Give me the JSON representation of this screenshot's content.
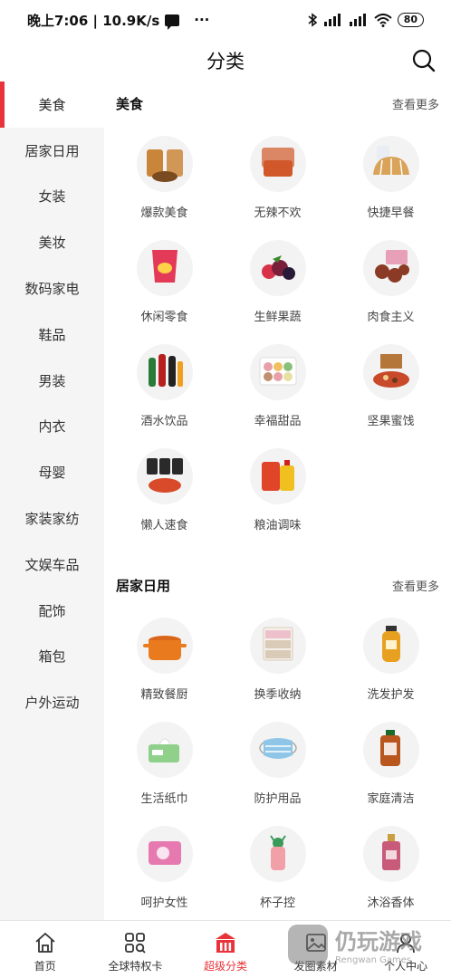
{
  "status_bar": {
    "time_speed": "晚上7:06 | 10.9K/s",
    "more": "···",
    "battery": "80"
  },
  "header": {
    "title": "分类"
  },
  "sidebar": {
    "items": [
      {
        "label": "美食"
      },
      {
        "label": "居家日用"
      },
      {
        "label": "女装"
      },
      {
        "label": "美妆"
      },
      {
        "label": "数码家电"
      },
      {
        "label": "鞋品"
      },
      {
        "label": "男装"
      },
      {
        "label": "内衣"
      },
      {
        "label": "母婴"
      },
      {
        "label": "家装家纺"
      },
      {
        "label": "文娱车品"
      },
      {
        "label": "配饰"
      },
      {
        "label": "箱包"
      },
      {
        "label": "户外运动"
      }
    ]
  },
  "sections": [
    {
      "title": "美食",
      "more": "查看更多",
      "items": [
        {
          "label": "爆款美食",
          "icon": "snack-bag-icon",
          "color": "#c9863a"
        },
        {
          "label": "无辣不欢",
          "icon": "spicy-meat-icon",
          "color": "#d0582a"
        },
        {
          "label": "快捷早餐",
          "icon": "bread-icon",
          "color": "#d9a35a"
        },
        {
          "label": "休闲零食",
          "icon": "chips-bag-icon",
          "color": "#e23a57"
        },
        {
          "label": "生鲜果蔬",
          "icon": "berries-icon",
          "color": "#7a1f3a"
        },
        {
          "label": "肉食主义",
          "icon": "braised-meat-icon",
          "color": "#8a3a25"
        },
        {
          "label": "酒水饮品",
          "icon": "bottles-icon",
          "color": "#b82020"
        },
        {
          "label": "幸福甜品",
          "icon": "macaron-icon",
          "color": "#e8a0a8"
        },
        {
          "label": "坚果蜜饯",
          "icon": "nuts-box-icon",
          "color": "#b5763a"
        },
        {
          "label": "懒人速食",
          "icon": "noodles-icon",
          "color": "#2a2a2a"
        },
        {
          "label": "粮油调味",
          "icon": "rice-oil-icon",
          "color": "#e0452a"
        }
      ]
    },
    {
      "title": "居家日用",
      "more": "查看更多",
      "items": [
        {
          "label": "精致餐厨",
          "icon": "pot-icon",
          "color": "#ea7a1e"
        },
        {
          "label": "换季收纳",
          "icon": "storage-drawer-icon",
          "color": "#d9cbb8"
        },
        {
          "label": "洗发护发",
          "icon": "shampoo-icon",
          "color": "#e8a020"
        },
        {
          "label": "生活纸巾",
          "icon": "tissue-icon",
          "color": "#8fd08a"
        },
        {
          "label": "防护用品",
          "icon": "mask-icon",
          "color": "#8fc6e8"
        },
        {
          "label": "家庭清洁",
          "icon": "disinfectant-icon",
          "color": "#b8561e"
        },
        {
          "label": "呵护女性",
          "icon": "pad-pack-icon",
          "color": "#e67ab0"
        },
        {
          "label": "杯子控",
          "icon": "cup-icon",
          "color": "#f2a0a8"
        },
        {
          "label": "沐浴香体",
          "icon": "perfume-icon",
          "color": "#c85a7a"
        }
      ]
    }
  ],
  "bottom_nav": [
    {
      "label": "首页",
      "icon": "home-icon"
    },
    {
      "label": "全球特权卡",
      "icon": "card-grid-icon"
    },
    {
      "label": "超级分类",
      "icon": "category-shop-icon",
      "active": true
    },
    {
      "label": "发圈素材",
      "icon": "image-icon"
    },
    {
      "label": "个人中心",
      "icon": "user-icon"
    }
  ],
  "watermark": {
    "text": "仍玩游戏",
    "sub": "Rengwan Games"
  },
  "colors": {
    "accent": "#e8333b",
    "sidebar_bg": "#f5f5f5"
  }
}
